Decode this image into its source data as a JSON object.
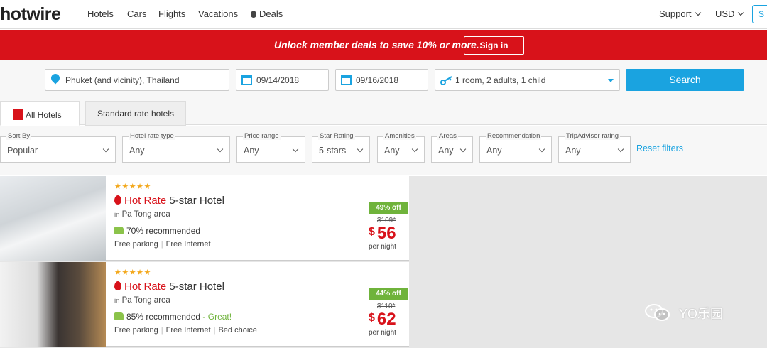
{
  "nav": {
    "logo": "hotwire",
    "items": [
      "Hotels",
      "Cars",
      "Flights",
      "Vacations",
      "Deals"
    ],
    "support": "Support",
    "currency": "USD",
    "cut_button": "S"
  },
  "banner": {
    "text": "Unlock member deals to save 10% or more.",
    "signin": "Sign in"
  },
  "search": {
    "destination": "Phuket (and vicinity), Thailand",
    "checkin": "09/14/2018",
    "checkout": "09/16/2018",
    "guests": "1 room, 2 adults, 1 child",
    "button": "Search"
  },
  "tabs": {
    "all": "All Hotels",
    "standard": "Standard rate hotels"
  },
  "filters": [
    {
      "label": "Sort By",
      "value": "Popular"
    },
    {
      "label": "Hotel rate type",
      "value": "Any"
    },
    {
      "label": "Price range",
      "value": "Any"
    },
    {
      "label": "Star Rating",
      "value": "5-stars"
    },
    {
      "label": "Amenities",
      "value": "Any"
    },
    {
      "label": "Areas",
      "value": "Any"
    },
    {
      "label": "Recommendation",
      "value": "Any"
    },
    {
      "label": "TripAdvisor rating",
      "value": "Any"
    }
  ],
  "reset": "Reset filters",
  "hotels": [
    {
      "stars": "★★★★★",
      "hot_label": "Hot Rate",
      "type": "5-star Hotel",
      "in_label": "in",
      "area": "Pa Tong area",
      "recommended": "70% recommended",
      "great": "",
      "amenities": [
        "Free parking",
        "Free Internet"
      ],
      "discount": "49% off",
      "original": "$109*",
      "currency": "$",
      "price": "56",
      "per": "per night"
    },
    {
      "stars": "★★★★★",
      "hot_label": "Hot Rate",
      "type": "5-star Hotel",
      "in_label": "in",
      "area": "Pa Tong area",
      "recommended": "85% recommended",
      "great": "- Great!",
      "amenities": [
        "Free parking",
        "Free Internet",
        "Bed choice"
      ],
      "discount": "44% off",
      "original": "$110*",
      "currency": "$",
      "price": "62",
      "per": "per night"
    }
  ],
  "watermark": "YO乐园",
  "colors": {
    "brand_red": "#d8121a",
    "accent_blue": "#1aa3e0",
    "discount_green": "#6fb33b",
    "star_gold": "#f3a81c"
  }
}
